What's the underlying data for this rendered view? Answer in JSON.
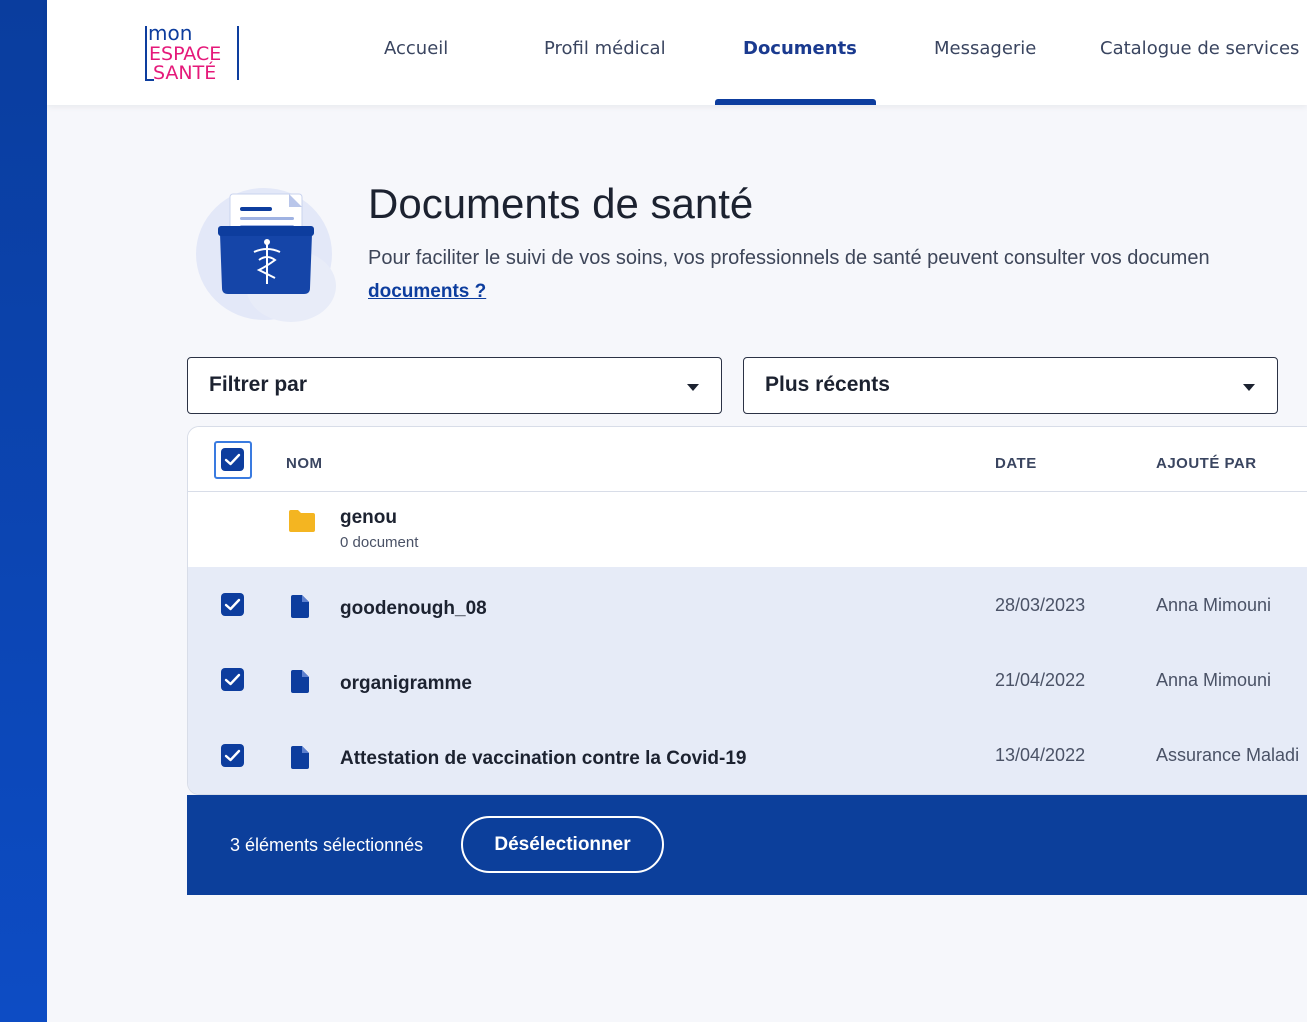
{
  "brand": {
    "logo_line1": "mon",
    "logo_line2": "ESPACE",
    "logo_line3": "SANTÉ",
    "color_navy": "#0d3d9e",
    "color_pink": "#e5197a"
  },
  "nav": {
    "items": [
      {
        "label": "Accueil",
        "active": false
      },
      {
        "label": "Profil médical",
        "active": false
      },
      {
        "label": "Documents",
        "active": true
      },
      {
        "label": "Messagerie",
        "active": false
      },
      {
        "label": "Catalogue de services",
        "active": false
      }
    ]
  },
  "page": {
    "title": "Documents de santé",
    "description": "Pour faciliter le suivi de vos soins, vos professionnels de santé peuvent consulter vos documen",
    "link": "documents ?"
  },
  "filters": {
    "filter_label": "Filtrer par",
    "sort_label": "Plus récents"
  },
  "table": {
    "columns": {
      "name": "NOM",
      "date": "DATE",
      "added_by": "AJOUTÉ PAR"
    },
    "folder": {
      "name": "genou",
      "count": "0 document"
    },
    "rows": [
      {
        "name": "goodenough_08",
        "date": "28/03/2023",
        "added_by": "Anna Mimouni",
        "selected": true
      },
      {
        "name": "organigramme",
        "date": "21/04/2022",
        "added_by": "Anna Mimouni",
        "selected": true
      },
      {
        "name": "Attestation de vaccination contre la Covid-19",
        "date": "13/04/2022",
        "added_by": "Assurance Maladi",
        "selected": true
      }
    ]
  },
  "selection_bar": {
    "count_text": "3 éléments sélectionnés",
    "deselect_label": "Désélectionner"
  }
}
